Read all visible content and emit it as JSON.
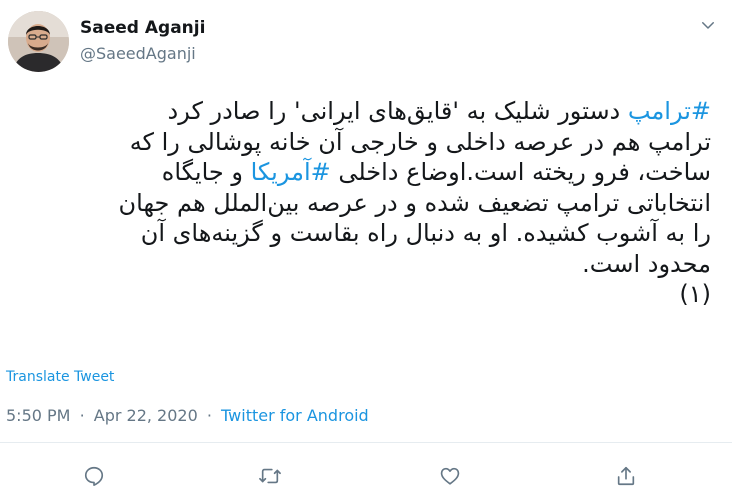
{
  "author": {
    "display_name": "Saeed Aganji",
    "handle": "@SaeedAganji"
  },
  "tweet": {
    "lines": [
      [
        {
          "text": "#ترامپ",
          "hashtag": true
        },
        {
          "text": " دستور شلیک به 'قایق‌های ایرانی' را صادر کرد",
          "hashtag": false
        }
      ],
      [
        {
          "text": "ترامپ هم در عرصه داخلی و خارجی آن خانه پوشالی را که",
          "hashtag": false
        }
      ],
      [
        {
          "text": "ساخت، فرو ریخته است.اوضاع داخلی ",
          "hashtag": false
        },
        {
          "text": "#آمریکا",
          "hashtag": true
        },
        {
          "text": " و جایگاه",
          "hashtag": false
        }
      ],
      [
        {
          "text": "انتخاباتی ترامپ تضعیف شده و در عرصه بین‌الملل هم جهان",
          "hashtag": false
        }
      ],
      [
        {
          "text": "را به آشوب کشیده. او به دنبال راه بقاست و گزینه‌های آن",
          "hashtag": false
        }
      ],
      [
        {
          "text": "محدود است.",
          "hashtag": false
        }
      ],
      [
        {
          "text": "(۱)",
          "hashtag": false
        }
      ]
    ]
  },
  "translate_label": "Translate Tweet",
  "meta": {
    "time": "5:50 PM",
    "separator": "·",
    "date": "Apr 22, 2020",
    "source": "Twitter for Android"
  },
  "actions": {
    "reply_icon": "reply-icon",
    "retweet_icon": "retweet-icon",
    "like_icon": "like-icon",
    "share_icon": "share-icon"
  },
  "colors": {
    "accent": "#1b95e0",
    "text": "#14171a",
    "muted": "#657786",
    "divider": "#e6ecf0"
  }
}
